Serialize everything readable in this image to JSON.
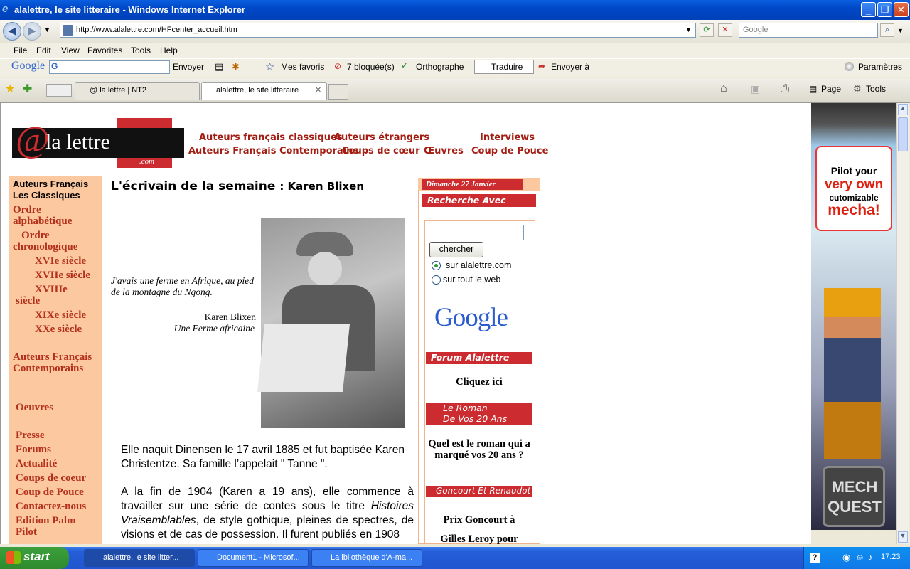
{
  "window": {
    "title": "alalettre, le site litteraire - Windows Internet Explorer"
  },
  "address": {
    "url": "http://www.alalettre.com/HFcenter_accueil.htm",
    "search_placeholder": "Google"
  },
  "menu": [
    "File",
    "Edit",
    "View",
    "Favorites",
    "Tools",
    "Help"
  ],
  "google_toolbar": {
    "logo": "Google",
    "send": "Envoyer",
    "favorites": "Mes favoris",
    "blocked": "7 bloquée(s)",
    "spelling": "Orthographe",
    "translate": "Traduire",
    "send_to": "Envoyer à",
    "settings": "Paramètres"
  },
  "tabs": [
    "@ la lettre | NT2",
    "alalettre, le site litteraire"
  ],
  "command_bar": {
    "page": "Page",
    "tools": "Tools"
  },
  "site": {
    "logo_main": "la lettre",
    "logo_at": "@",
    "logo_com": ".com",
    "nav_row1": [
      "Auteurs français classiques",
      "Auteurs étrangers",
      "Interviews"
    ],
    "nav_row2": [
      "Auteurs Français Contemporains",
      "Coups de cœur",
      "Œuvres",
      "Coup de Pouce"
    ],
    "left": {
      "heading1": "Auteurs Français",
      "heading2": "Les Classiques",
      "order_alpha": "Ordre alphabétique",
      "order_chrono": "Ordre chronologique",
      "centuries": [
        "XVIe siècle",
        "XVIIe siècle",
        "XVIIIe siècle",
        "XIXe siècle",
        "XXe siècle"
      ],
      "contemp": "Auteurs Français Contemporains",
      "oeuvres": "Oeuvres",
      "links": [
        "Presse",
        "Forums",
        "Actualité",
        "Coups de coeur",
        "Coup de Pouce",
        "Contactez-nous",
        "Edition Palm Pilot"
      ]
    },
    "main": {
      "title": "L'écrivain de la semaine",
      "title_name": ": Karen Blixen",
      "quote": "J'avais une ferme en Afrique, au pied de la montagne du Ngong.",
      "quote_author": "Karen Blixen",
      "quote_work": "Une Ferme africaine",
      "para1": "Elle naquit Dinensen le 17 avril 1885 et fut baptisée Karen Christentze. Sa famille l’appelait \" Tanne \".",
      "para2_a": "A la fin de 1904 (Karen a 19 ans), elle commence à travailler sur une série de contes sous le titre ",
      "para2_em": "Histoires Vraisemblables",
      "para2_b": ", de style gothique, pleines de spectres, de visions et de cas de possession. Il furent publiés en 1908"
    },
    "right": {
      "date": "Dimanche 27 Janvier",
      "search_title": "Recherche Avec Google",
      "search_button": "chercher",
      "radio1": "sur alalettre.com",
      "radio2": "sur tout le web",
      "google_logo": "Google",
      "forum_title": "Forum Alalettre",
      "forum_link": "Cliquez ici",
      "roman_title1": "Le Roman",
      "roman_title2": "De Vos 20 Ans",
      "roman_q": "Quel est le roman qui a marqué vos 20 ans ?",
      "goncourt_title": "Goncourt Et Renaudot",
      "goncourt_text1": "Prix Goncourt à",
      "goncourt_text2": "Gilles Leroy pour"
    },
    "ad": {
      "line1": "Pilot your",
      "line2": "very own",
      "line3": "cutomizable",
      "line4": "mecha!",
      "brand1": "MECH",
      "brand2": "QUEST"
    }
  },
  "taskbar": {
    "start": "start",
    "tasks": [
      "alalettre, le site litter...",
      "Document1 - Microsof...",
      "La ibliothèque d'A-ma..."
    ],
    "clock": "17:23"
  }
}
